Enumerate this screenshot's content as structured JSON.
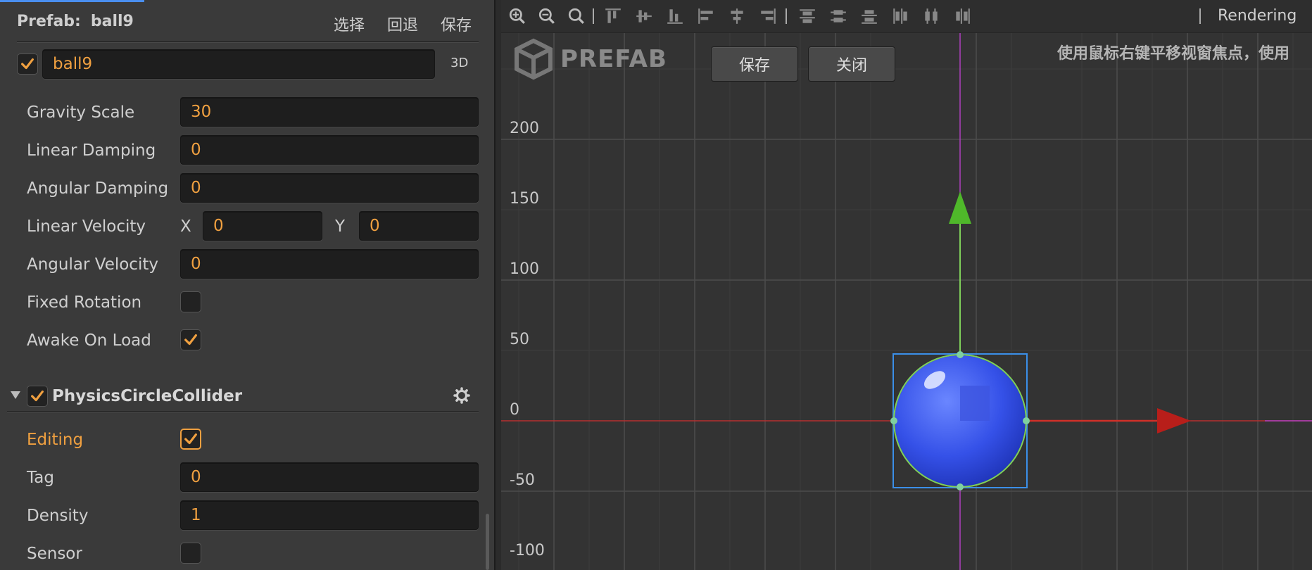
{
  "inspector": {
    "prefab_label": "Prefab:",
    "prefab_name": "ball9",
    "actions": {
      "select": "选择",
      "revert": "回退",
      "save": "保存"
    },
    "node": {
      "active": true,
      "name": "ball9",
      "mode": "3D"
    },
    "rigidbody_props": [
      {
        "label": "Gravity Scale",
        "value": "30"
      },
      {
        "label": "Linear Damping",
        "value": "0"
      },
      {
        "label": "Angular Damping",
        "value": "0"
      }
    ],
    "linear_velocity": {
      "label": "Linear Velocity",
      "x_label": "X",
      "x": "0",
      "y_label": "Y",
      "y": "0"
    },
    "angular_velocity": {
      "label": "Angular Velocity",
      "value": "0"
    },
    "fixed_rotation": {
      "label": "Fixed Rotation",
      "checked": false
    },
    "awake_on_load": {
      "label": "Awake On Load",
      "checked": true
    },
    "collider": {
      "enabled": true,
      "title": "PhysicsCircleCollider",
      "editing": {
        "label": "Editing",
        "checked": true
      },
      "tag": {
        "label": "Tag",
        "value": "0"
      },
      "density": {
        "label": "Density",
        "value": "1"
      },
      "sensor": {
        "label": "Sensor",
        "checked": false
      }
    }
  },
  "scene": {
    "toolbar": {
      "rendering": "Rendering"
    },
    "logo_text": "PREFAB",
    "buttons": {
      "save": "保存",
      "close": "关闭"
    },
    "hint": "使用鼠标右键平移视窗焦点，使用",
    "y_axis_labels": [
      "200",
      "150",
      "100",
      "50",
      "0",
      "-50",
      "-100"
    ]
  },
  "colors": {
    "accent": "#f0a040",
    "x_axis": "#c0302a",
    "y_axis": "#7fd05a",
    "selection": "#3b8fe8",
    "ball": "#3a5cf0"
  }
}
